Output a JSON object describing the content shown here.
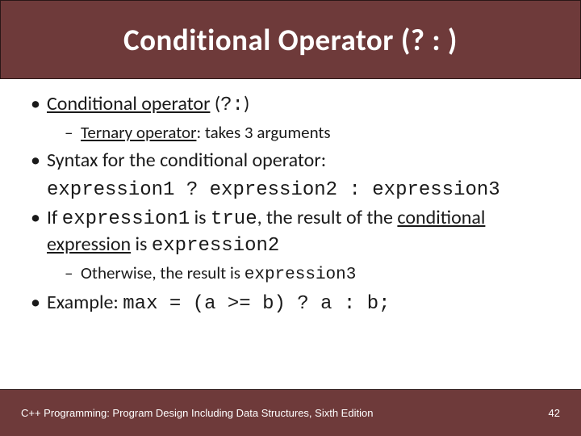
{
  "title": "Conditional Operator (? : )",
  "bullets": {
    "b1_pre": "Conditional operator",
    "b1_paren_open": " (",
    "b1_op": "?:",
    "b1_paren_close": ")",
    "b1_sub_pre": "Ternary operator",
    "b1_sub_post": ": takes 3 arguments",
    "b2": "Syntax for the conditional operator:",
    "syntax": "expression1 ? expression2 : expression3",
    "b3_a": "If ",
    "b3_expr1": "expression1",
    "b3_b": " is ",
    "b3_true": "true",
    "b3_c": ", the result of the ",
    "b3_d": "conditional expression",
    "b3_e": " is ",
    "b3_expr2": "expression2",
    "b3_sub_a": "Otherwise, the result is ",
    "b3_sub_expr3": "expression3",
    "b4_a": "Example: ",
    "b4_code": "max = (a >= b) ? a : b;"
  },
  "footer": {
    "text": "C++ Programming: Program Design Including Data Structures, Sixth Edition",
    "page": "42"
  }
}
